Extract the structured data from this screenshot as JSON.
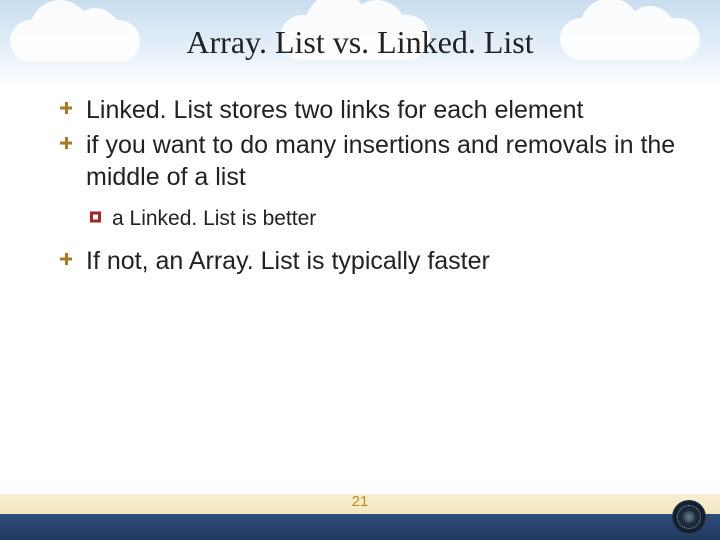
{
  "title": "Array. List vs. Linked. List",
  "bullets": {
    "b1": "Linked. List stores two links for each element",
    "b2": "if you want to do many insertions and removals in the middle of a list",
    "sub1": "a Linked. List is better",
    "b3": "If not, an Array. List is typically faster"
  },
  "page_number": "21"
}
